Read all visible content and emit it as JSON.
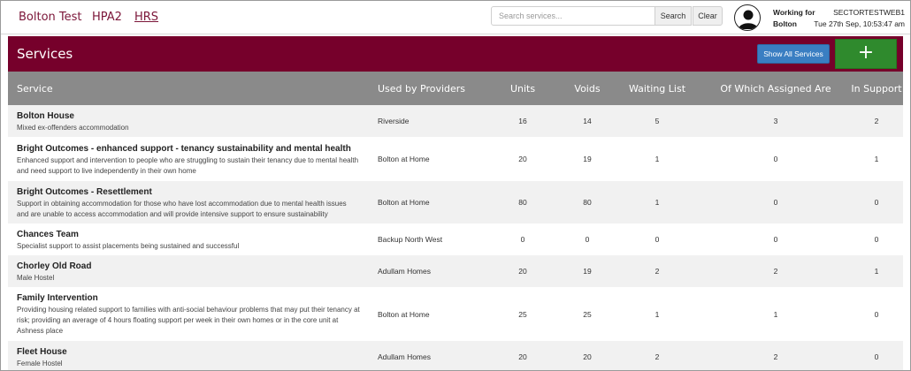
{
  "nav": {
    "brand": "Bolton Test",
    "link_hpa2": "HPA2",
    "link_hrs": "HRS"
  },
  "search": {
    "placeholder": "Search services...",
    "search_label": "Search",
    "clear_label": "Clear"
  },
  "user": {
    "working_line1": "Working for",
    "working_line2": "Bolton",
    "system_name": "SECTORTESTWEB1",
    "datetime": "Tue 27th Sep, 10:53:47 am"
  },
  "header": {
    "title": "Services",
    "show_all_label": "Show All Services",
    "add_label": "+"
  },
  "table": {
    "columns": [
      "Service",
      "Used by Providers",
      "Units",
      "Voids",
      "Waiting List",
      "Of Which Assigned Are",
      "In Support"
    ],
    "rows": [
      {
        "name": "Bolton House",
        "desc": "Mixed ex-offenders accommodation",
        "provider": "Riverside",
        "units": "16",
        "voids": "14",
        "waiting": "5",
        "assigned": "3",
        "support": "2"
      },
      {
        "name": "Bright Outcomes - enhanced support - tenancy sustainability and mental health",
        "desc": "Enhanced support and intervention to people who are struggling to sustain their tenancy due to mental health and need support to live independently in their own home",
        "provider": "Bolton at Home",
        "units": "20",
        "voids": "19",
        "waiting": "1",
        "assigned": "0",
        "support": "1"
      },
      {
        "name": "Bright Outcomes - Resettlement",
        "desc": "Support in obtaining accommodation for those who have lost accommodation due to mental health issues and are unable to access accommodation and will provide intensive support to ensure sustainability",
        "provider": "Bolton at Home",
        "units": "80",
        "voids": "80",
        "waiting": "1",
        "assigned": "0",
        "support": "0"
      },
      {
        "name": "Chances Team",
        "desc": "Specialist support to assist placements being sustained and successful",
        "provider": "Backup North West",
        "units": "0",
        "voids": "0",
        "waiting": "0",
        "assigned": "0",
        "support": "0"
      },
      {
        "name": "Chorley Old Road",
        "desc": "Male Hostel",
        "provider": "Adullam Homes",
        "units": "20",
        "voids": "19",
        "waiting": "2",
        "assigned": "2",
        "support": "1"
      },
      {
        "name": "Family Intervention",
        "desc": "Providing housing related support to families with anti-social behaviour problems that may put their tenancy at risk; providing an average of 4 hours floating support per week in their own homes or in the core unit at Ashness place",
        "provider": "Bolton at Home",
        "units": "25",
        "voids": "25",
        "waiting": "1",
        "assigned": "1",
        "support": "0"
      },
      {
        "name": "Fleet House",
        "desc": "Female Hostel",
        "provider": "Adullam Homes",
        "units": "20",
        "voids": "20",
        "waiting": "2",
        "assigned": "2",
        "support": "0"
      }
    ]
  },
  "colors": {
    "brand": "#7b1538",
    "header_band": "#76002b",
    "show_all_button": "#3a7ec2",
    "add_button": "#2f8a2d",
    "table_header": "#8a8a8a"
  }
}
